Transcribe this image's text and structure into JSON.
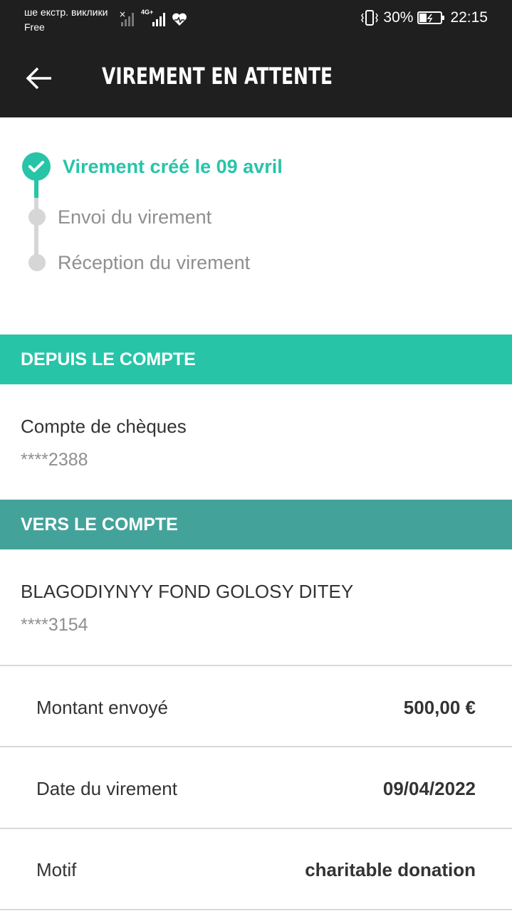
{
  "status_bar": {
    "carrier_line1": "ше екстр. виклики",
    "carrier_line2": "Free",
    "network_label": "4G+",
    "battery": "30%",
    "time": "22:15"
  },
  "app_bar": {
    "title": "VIREMENT EN ATTENTE",
    "back_icon": "arrow-left-icon"
  },
  "steps": [
    {
      "label": "Virement créé le 09 avril",
      "state": "done"
    },
    {
      "label": "Envoi du virement",
      "state": "pending"
    },
    {
      "label": "Réception du virement",
      "state": "pending"
    }
  ],
  "from": {
    "header": "DEPUIS LE COMPTE",
    "account_name": "Compte de chèques",
    "account_number": "****2388",
    "header_color": "#27c4a8"
  },
  "to": {
    "header": "VERS LE COMPTE",
    "account_name": "BLAGODIYNYY FOND GOLOSY DITEY",
    "account_number": "****3154",
    "header_color": "#43a39a"
  },
  "details": [
    {
      "label": "Montant envoyé",
      "value": "500,00 €"
    },
    {
      "label": "Date du virement",
      "value": "09/04/2022"
    },
    {
      "label": "Motif",
      "value": "charitable donation"
    }
  ],
  "colors": {
    "accent": "#27c4a8",
    "bar": "#1f1f1f"
  }
}
